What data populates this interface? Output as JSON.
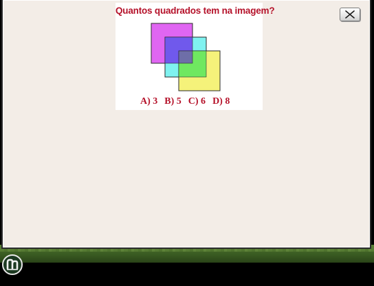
{
  "puzzle": {
    "question": "Quantos quadrados tem na imagem?",
    "options": [
      "A) 3",
      "B) 5",
      "C) 6",
      "D) 8"
    ],
    "square_colors": {
      "magenta": "#e066f2",
      "cyan": "#7ff2f0",
      "yellow": "#f5f27a",
      "blue_overlap": "#7059ec",
      "green_overlap": "#6fe860",
      "center_overlap": "#6e6ea8"
    }
  },
  "dialog": {
    "close_icon": "close-icon"
  },
  "taskbar": {
    "logo_icon": "app-logo-icon"
  }
}
